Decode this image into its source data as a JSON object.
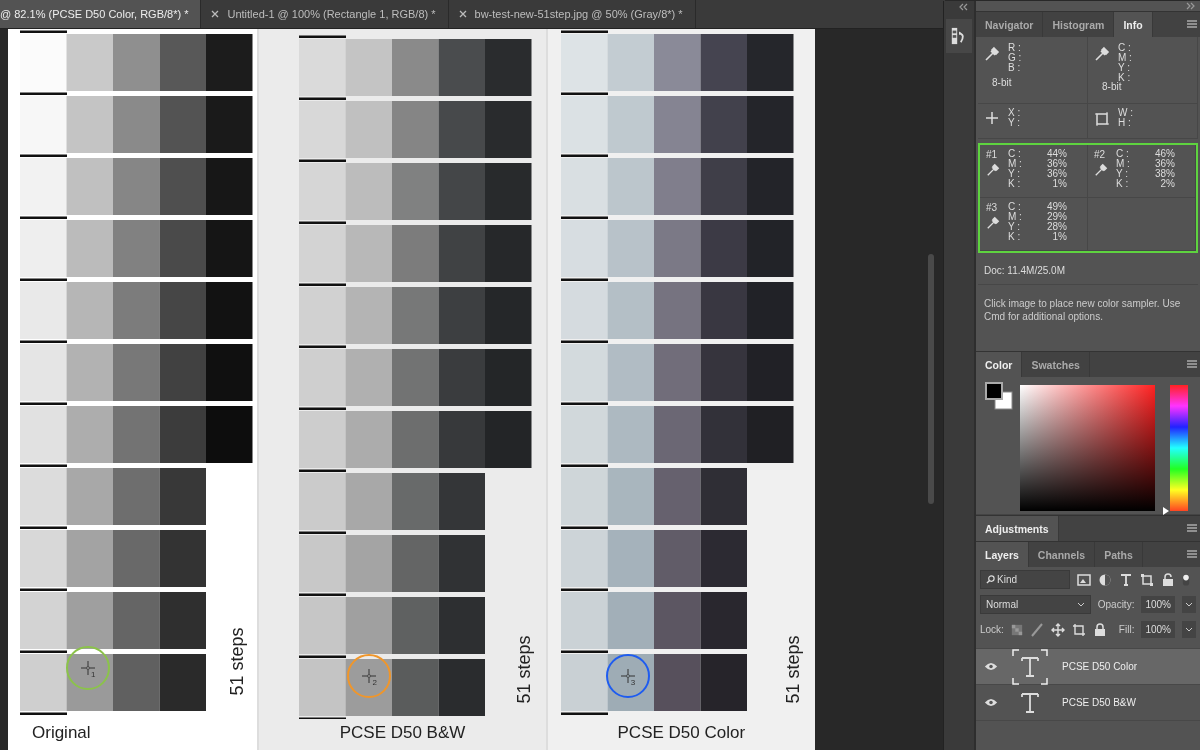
{
  "document_tabs": [
    {
      "label": "@ 82.1% (PCSE D50 Color, RGB/8*) *",
      "selected": true,
      "closable": false
    },
    {
      "label": "Untitled-1 @ 100% (Rectangle 1, RGB/8) *",
      "selected": false,
      "closable": true
    },
    {
      "label": "bw-test-new-51step.jpg @ 50% (Gray/8*) *",
      "selected": false,
      "closable": true
    }
  ],
  "canvas": {
    "panels": [
      {
        "kind": "original",
        "label": "Original",
        "steps_label": "51 steps",
        "sampler": {
          "number": "1",
          "color": "#8bc34a"
        }
      },
      {
        "kind": "bw",
        "label": "PCSE D50 B&W",
        "steps_label": "51 steps",
        "sampler": {
          "number": "2",
          "color": "#f0962a"
        }
      },
      {
        "kind": "color",
        "label": "PCSE D50 Color",
        "steps_label": "51 steps",
        "sampler": {
          "number": "3",
          "color": "#1e5cf0"
        }
      }
    ]
  },
  "info_panel": {
    "tabs": [
      {
        "label": "Navigator",
        "selected": false
      },
      {
        "label": "Histogram",
        "selected": false
      },
      {
        "label": "Info",
        "selected": true
      }
    ],
    "rgb": {
      "labels": [
        "R :",
        "G :",
        "B :"
      ],
      "bits": "8-bit"
    },
    "cmyk": {
      "labels": [
        "C :",
        "M :",
        "Y :",
        "K :"
      ],
      "bits": "8-bit"
    },
    "position": {
      "labels": [
        "X :",
        "Y :"
      ]
    },
    "size": {
      "labels": [
        "W :",
        "H :"
      ]
    },
    "samplers": [
      {
        "id": "#1",
        "rows": [
          {
            "label": "C :",
            "value": "44%"
          },
          {
            "label": "M :",
            "value": "36%"
          },
          {
            "label": "Y :",
            "value": "36%"
          },
          {
            "label": "K :",
            "value": "1%"
          }
        ]
      },
      {
        "id": "#2",
        "rows": [
          {
            "label": "C :",
            "value": "46%"
          },
          {
            "label": "M :",
            "value": "36%"
          },
          {
            "label": "Y :",
            "value": "38%"
          },
          {
            "label": "K :",
            "value": "2%"
          }
        ]
      },
      {
        "id": "#3",
        "rows": [
          {
            "label": "C :",
            "value": "49%"
          },
          {
            "label": "M :",
            "value": "29%"
          },
          {
            "label": "Y :",
            "value": "28%"
          },
          {
            "label": "K :",
            "value": "1%"
          }
        ]
      }
    ],
    "doc": "Doc: 11.4M/25.0M",
    "hint": "Click image to place new color sampler.  Use Cmd for additional options."
  },
  "color_panel": {
    "tabs": [
      {
        "label": "Color",
        "selected": true
      },
      {
        "label": "Swatches",
        "selected": false
      }
    ],
    "hue": {
      "level": 0
    }
  },
  "adjustments_panel": {
    "tabs": [
      {
        "label": "Adjustments",
        "selected": true
      }
    ]
  },
  "layers_panel": {
    "tabs": [
      {
        "label": "Layers",
        "selected": true
      },
      {
        "label": "Channels",
        "selected": false
      },
      {
        "label": "Paths",
        "selected": false
      }
    ],
    "filter": "Kind",
    "blend_mode": "Normal",
    "opacity_label": "Opacity:",
    "opacity": "100%",
    "lock_label": "Lock:",
    "fill_label": "Fill:",
    "fill": "100%",
    "layers": [
      {
        "name": "PCSE D50 Color",
        "kind": "text",
        "selected": true,
        "visible": true
      },
      {
        "name": "PCSE D50 B&W",
        "kind": "text",
        "selected": false,
        "visible": true
      }
    ]
  }
}
